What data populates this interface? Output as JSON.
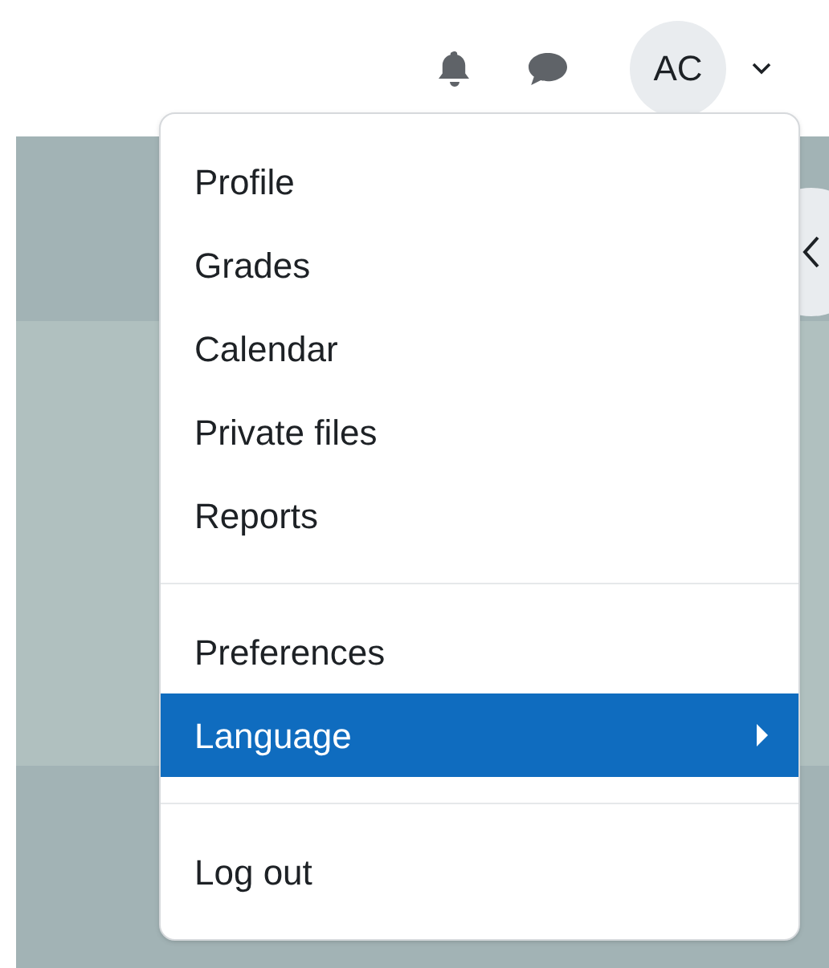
{
  "navbar": {
    "avatar_initials": "AC"
  },
  "user_menu": {
    "groups": [
      {
        "items": [
          {
            "label": "Profile",
            "selected": false,
            "has_submenu": false
          },
          {
            "label": "Grades",
            "selected": false,
            "has_submenu": false
          },
          {
            "label": "Calendar",
            "selected": false,
            "has_submenu": false
          },
          {
            "label": "Private files",
            "selected": false,
            "has_submenu": false
          },
          {
            "label": "Reports",
            "selected": false,
            "has_submenu": false
          }
        ]
      },
      {
        "items": [
          {
            "label": "Preferences",
            "selected": false,
            "has_submenu": false
          },
          {
            "label": "Language",
            "selected": true,
            "has_submenu": true
          }
        ]
      },
      {
        "items": [
          {
            "label": "Log out",
            "selected": false,
            "has_submenu": false
          }
        ]
      }
    ]
  }
}
